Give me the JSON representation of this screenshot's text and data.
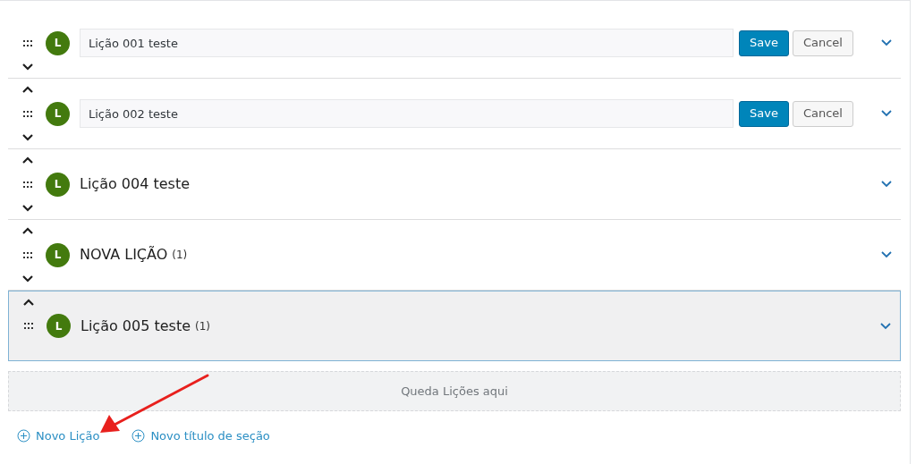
{
  "lessons": [
    {
      "kind": "editing",
      "avatar": "L",
      "title": "Lição 001 teste",
      "can_move_up": false,
      "can_move_down": true,
      "selected": false,
      "save": "Save",
      "cancel": "Cancel"
    },
    {
      "kind": "editing",
      "avatar": "L",
      "title": "Lição 002 teste",
      "can_move_up": true,
      "can_move_down": true,
      "selected": false,
      "save": "Save",
      "cancel": "Cancel"
    },
    {
      "kind": "title",
      "avatar": "L",
      "title": "Lição 004 teste",
      "can_move_up": true,
      "can_move_down": true,
      "selected": false
    },
    {
      "kind": "title",
      "avatar": "L",
      "title": "NOVA LIÇÃO",
      "count": "(1)",
      "can_move_up": true,
      "can_move_down": true,
      "selected": false
    },
    {
      "kind": "title",
      "avatar": "L",
      "title": "Lição 005 teste",
      "count": "(1)",
      "can_move_up": true,
      "can_move_down": false,
      "selected": true
    }
  ],
  "drop_zone": "Queda Lições aqui",
  "links": [
    "Novo Lição",
    "Novo título de seção"
  ]
}
